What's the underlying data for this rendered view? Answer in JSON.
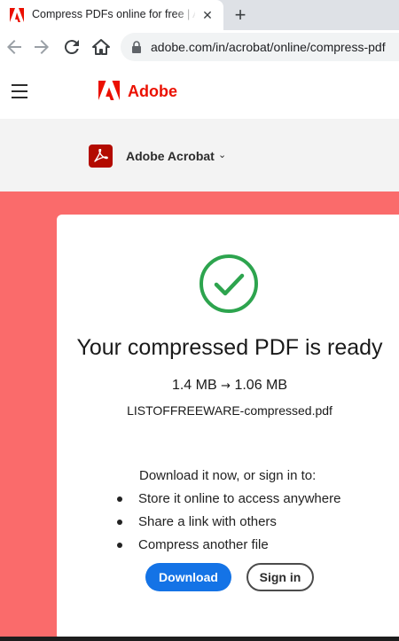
{
  "browser": {
    "tab_title": "Compress PDFs online for free | Adobe Acrobat",
    "tab_close": "✕",
    "new_tab": "+",
    "url": "adobe.com/in/acrobat/online/compress-pdf"
  },
  "header": {
    "brand": "Adobe",
    "product": "Adobe Acrobat",
    "chevron": "⌄"
  },
  "result": {
    "title": "Your compressed PDF is ready",
    "size_before": "1.4 MB",
    "size_arrow": "→",
    "size_after": "1.06 MB",
    "filename": "LISTOFFREEWARE-compressed.pdf",
    "prompt": "Download it now, or sign in to:",
    "benefits": [
      "Store it online to access anywhere",
      "Share a link with others",
      "Compress another file"
    ],
    "download_label": "Download",
    "signin_label": "Sign in"
  },
  "colors": {
    "adobe_red": "#eb1000",
    "hero_bg": "#fa6b6b",
    "check_green": "#2da44e",
    "primary_blue": "#1473e6"
  }
}
